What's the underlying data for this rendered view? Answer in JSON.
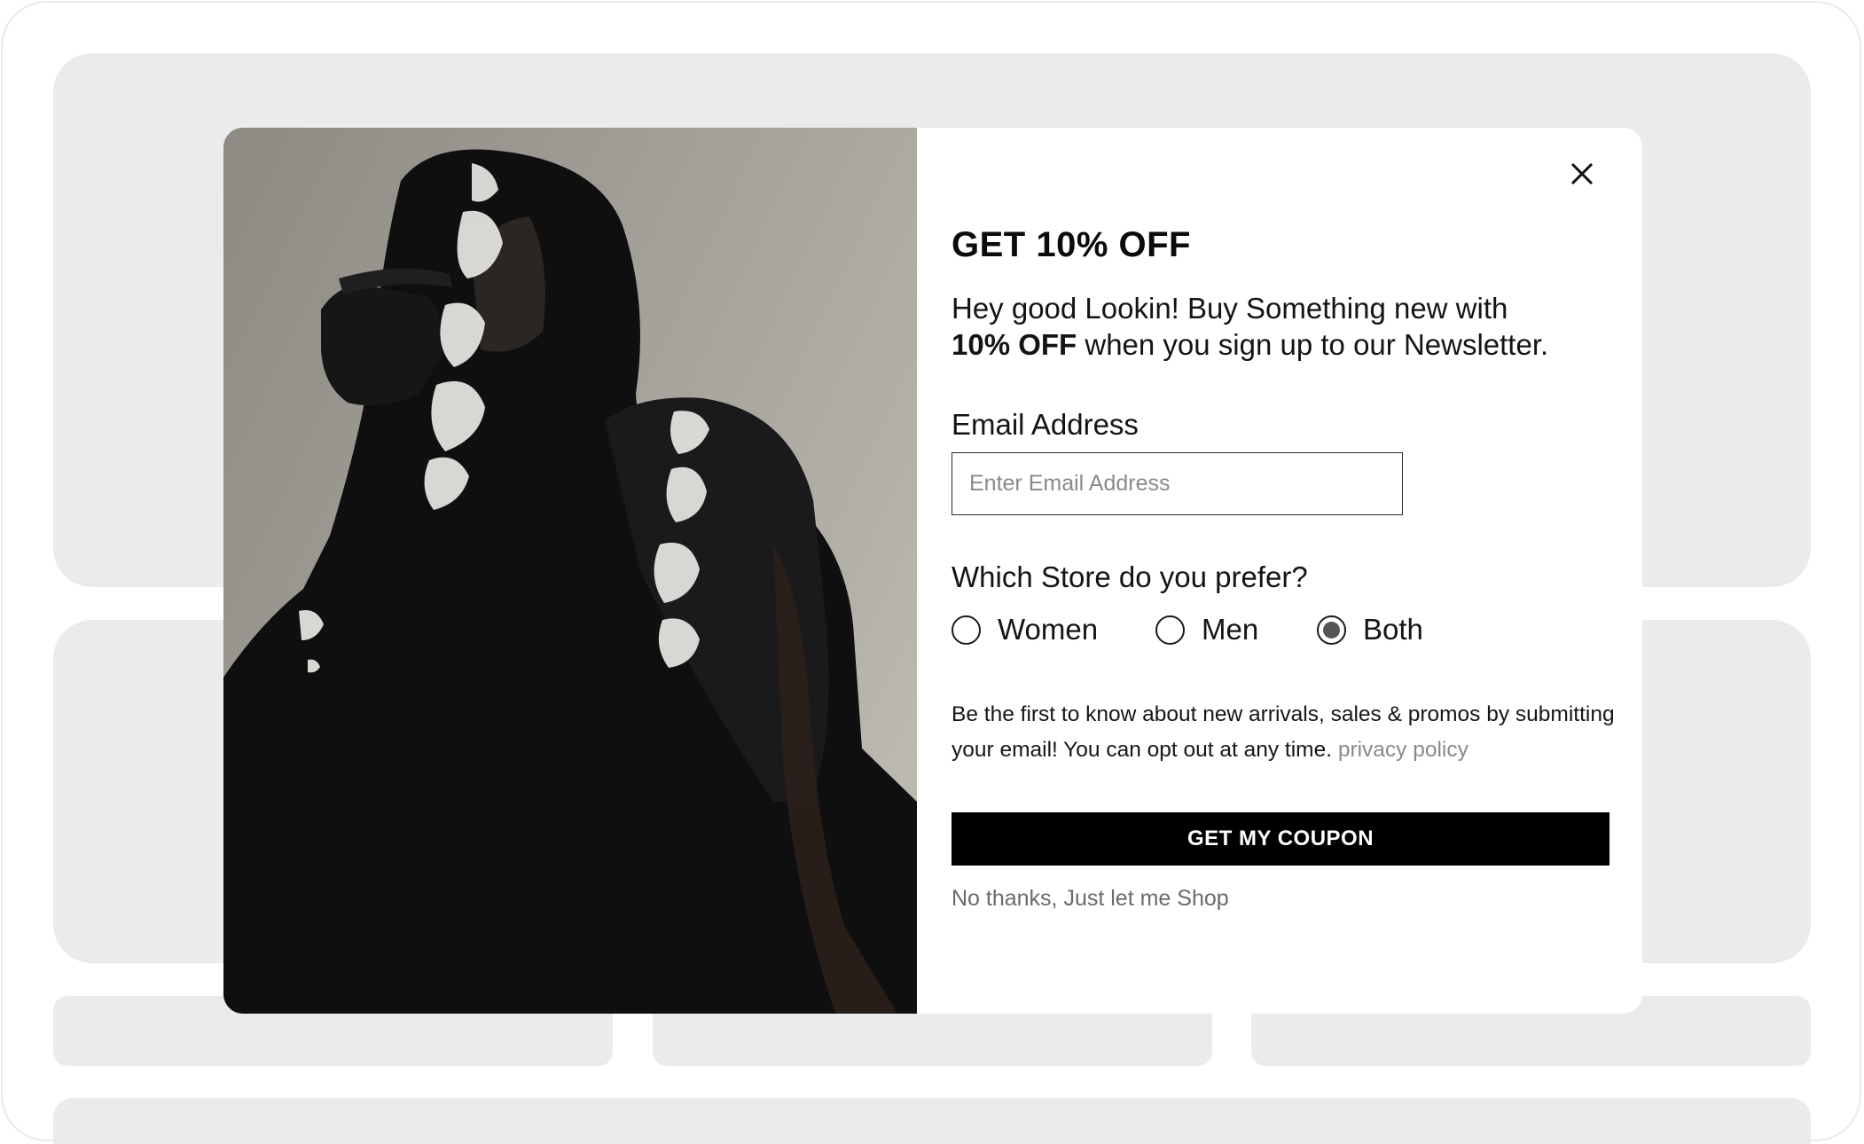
{
  "popup": {
    "title": "GET 10% OFF",
    "subtitle_line1": "Hey good Lookin! Buy Something new with",
    "subtitle_bold": "10% OFF",
    "subtitle_rest": " when you sign up to our Newsletter.",
    "email": {
      "label": "Email Address",
      "placeholder": "Enter Email Address",
      "value": ""
    },
    "store_question": "Which Store do you prefer?",
    "store_options": [
      {
        "label": "Women",
        "selected": false
      },
      {
        "label": "Men",
        "selected": false
      },
      {
        "label": "Both",
        "selected": true
      }
    ],
    "disclaimer": "Be the first to know about new arrivals, sales & promos by submitting your email! You can opt out at any time.",
    "privacy_link": "privacy policy",
    "cta_label": "GET MY COUPON",
    "dismiss_label": "No thanks, Just let me Shop"
  },
  "colors": {
    "cta_background": "#000000",
    "placeholder_block": "#ebebed",
    "link": "#8a8a8a"
  },
  "icons": {
    "close": "close-icon",
    "photo": "hoodie-models-photo"
  }
}
